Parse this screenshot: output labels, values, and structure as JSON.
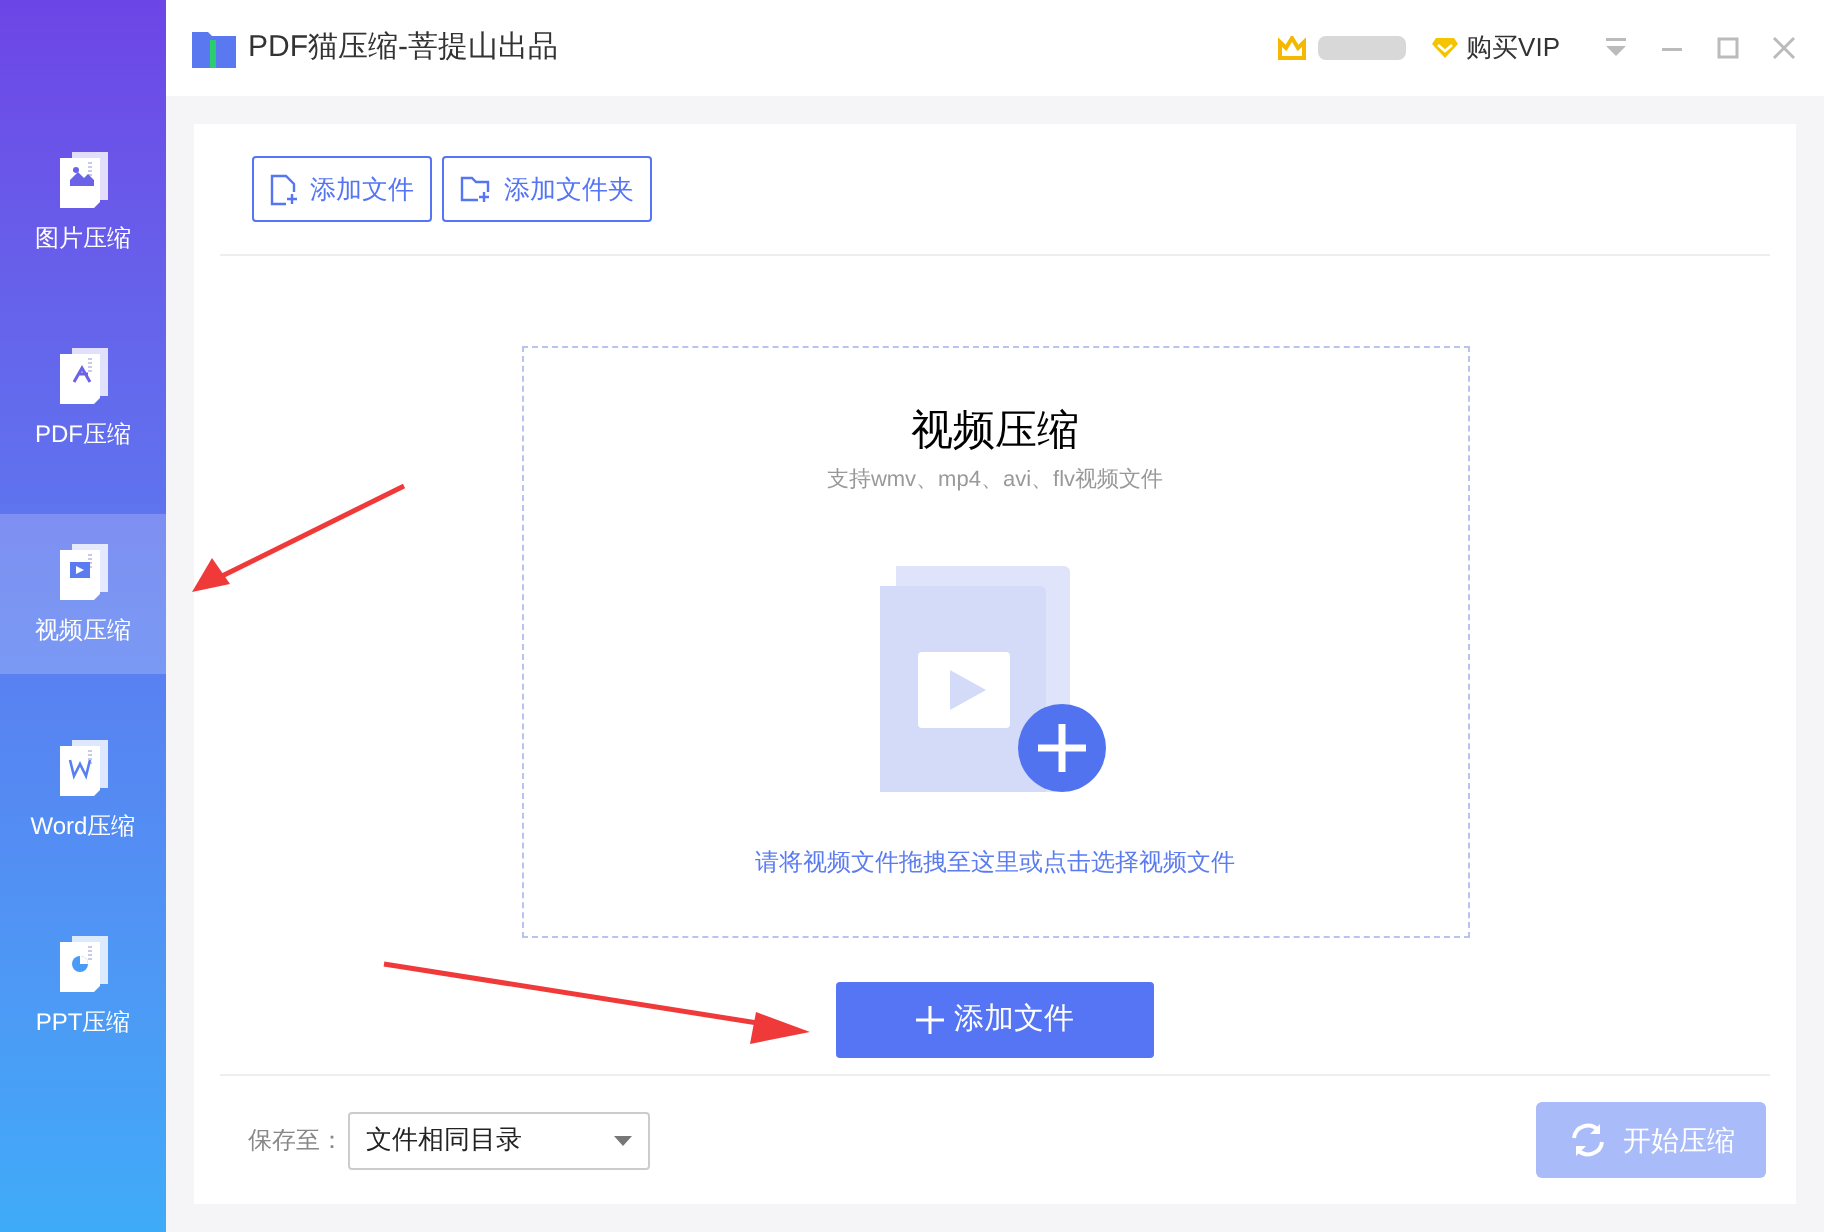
{
  "window": {
    "title": "PDF猫压缩-菩提山出品",
    "vip_label": "购买VIP"
  },
  "sidebar": {
    "items": [
      {
        "label": "图片压缩",
        "kind": "image",
        "selected": false
      },
      {
        "label": "PDF压缩",
        "kind": "pdf",
        "selected": false
      },
      {
        "label": "视频压缩",
        "kind": "video",
        "selected": true
      },
      {
        "label": "Word压缩",
        "kind": "word",
        "selected": false
      },
      {
        "label": "PPT压缩",
        "kind": "ppt",
        "selected": false
      }
    ]
  },
  "toolbar": {
    "buttons": [
      {
        "label": "添加文件",
        "kind": "file"
      },
      {
        "label": "添加文件夹",
        "kind": "folder"
      }
    ]
  },
  "drop_zone": {
    "title": "视频压缩",
    "subtitle": "支持wmv、mp4、avi、flv视频文件",
    "hint": "请将视频文件拖拽至这里或点击选择视频文件"
  },
  "add_button": {
    "label": "添加文件"
  },
  "footer": {
    "save_label": "保存至：",
    "save_target": "文件相同目录",
    "start_button": {
      "label": "开始压缩",
      "disabled": true
    }
  }
}
